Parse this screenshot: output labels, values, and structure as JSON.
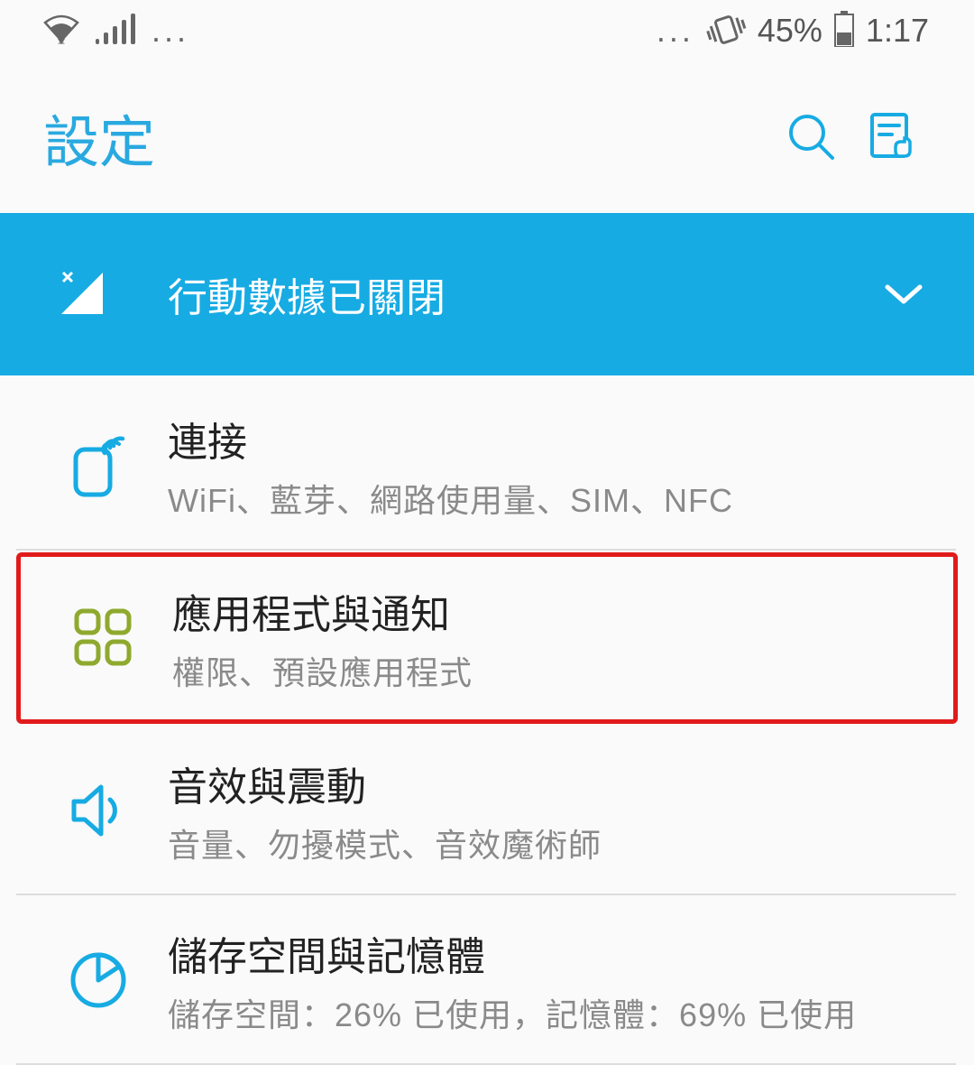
{
  "status_bar": {
    "battery_percent": "45%",
    "time": "1:17",
    "dots": "..."
  },
  "header": {
    "title": "設定"
  },
  "banner": {
    "text": "行動數據已關閉"
  },
  "items": [
    {
      "title": "連接",
      "subtitle": "WiFi、藍芽、網路使用量、SIM、NFC"
    },
    {
      "title": "應用程式與通知",
      "subtitle": "權限、預設應用程式"
    },
    {
      "title": "音效與震動",
      "subtitle": "音量、勿擾模式、音效魔術師"
    },
    {
      "title": "儲存空間與記憶體",
      "subtitle": "儲存空間：26% 已使用，記憶體：69% 已使用"
    }
  ]
}
